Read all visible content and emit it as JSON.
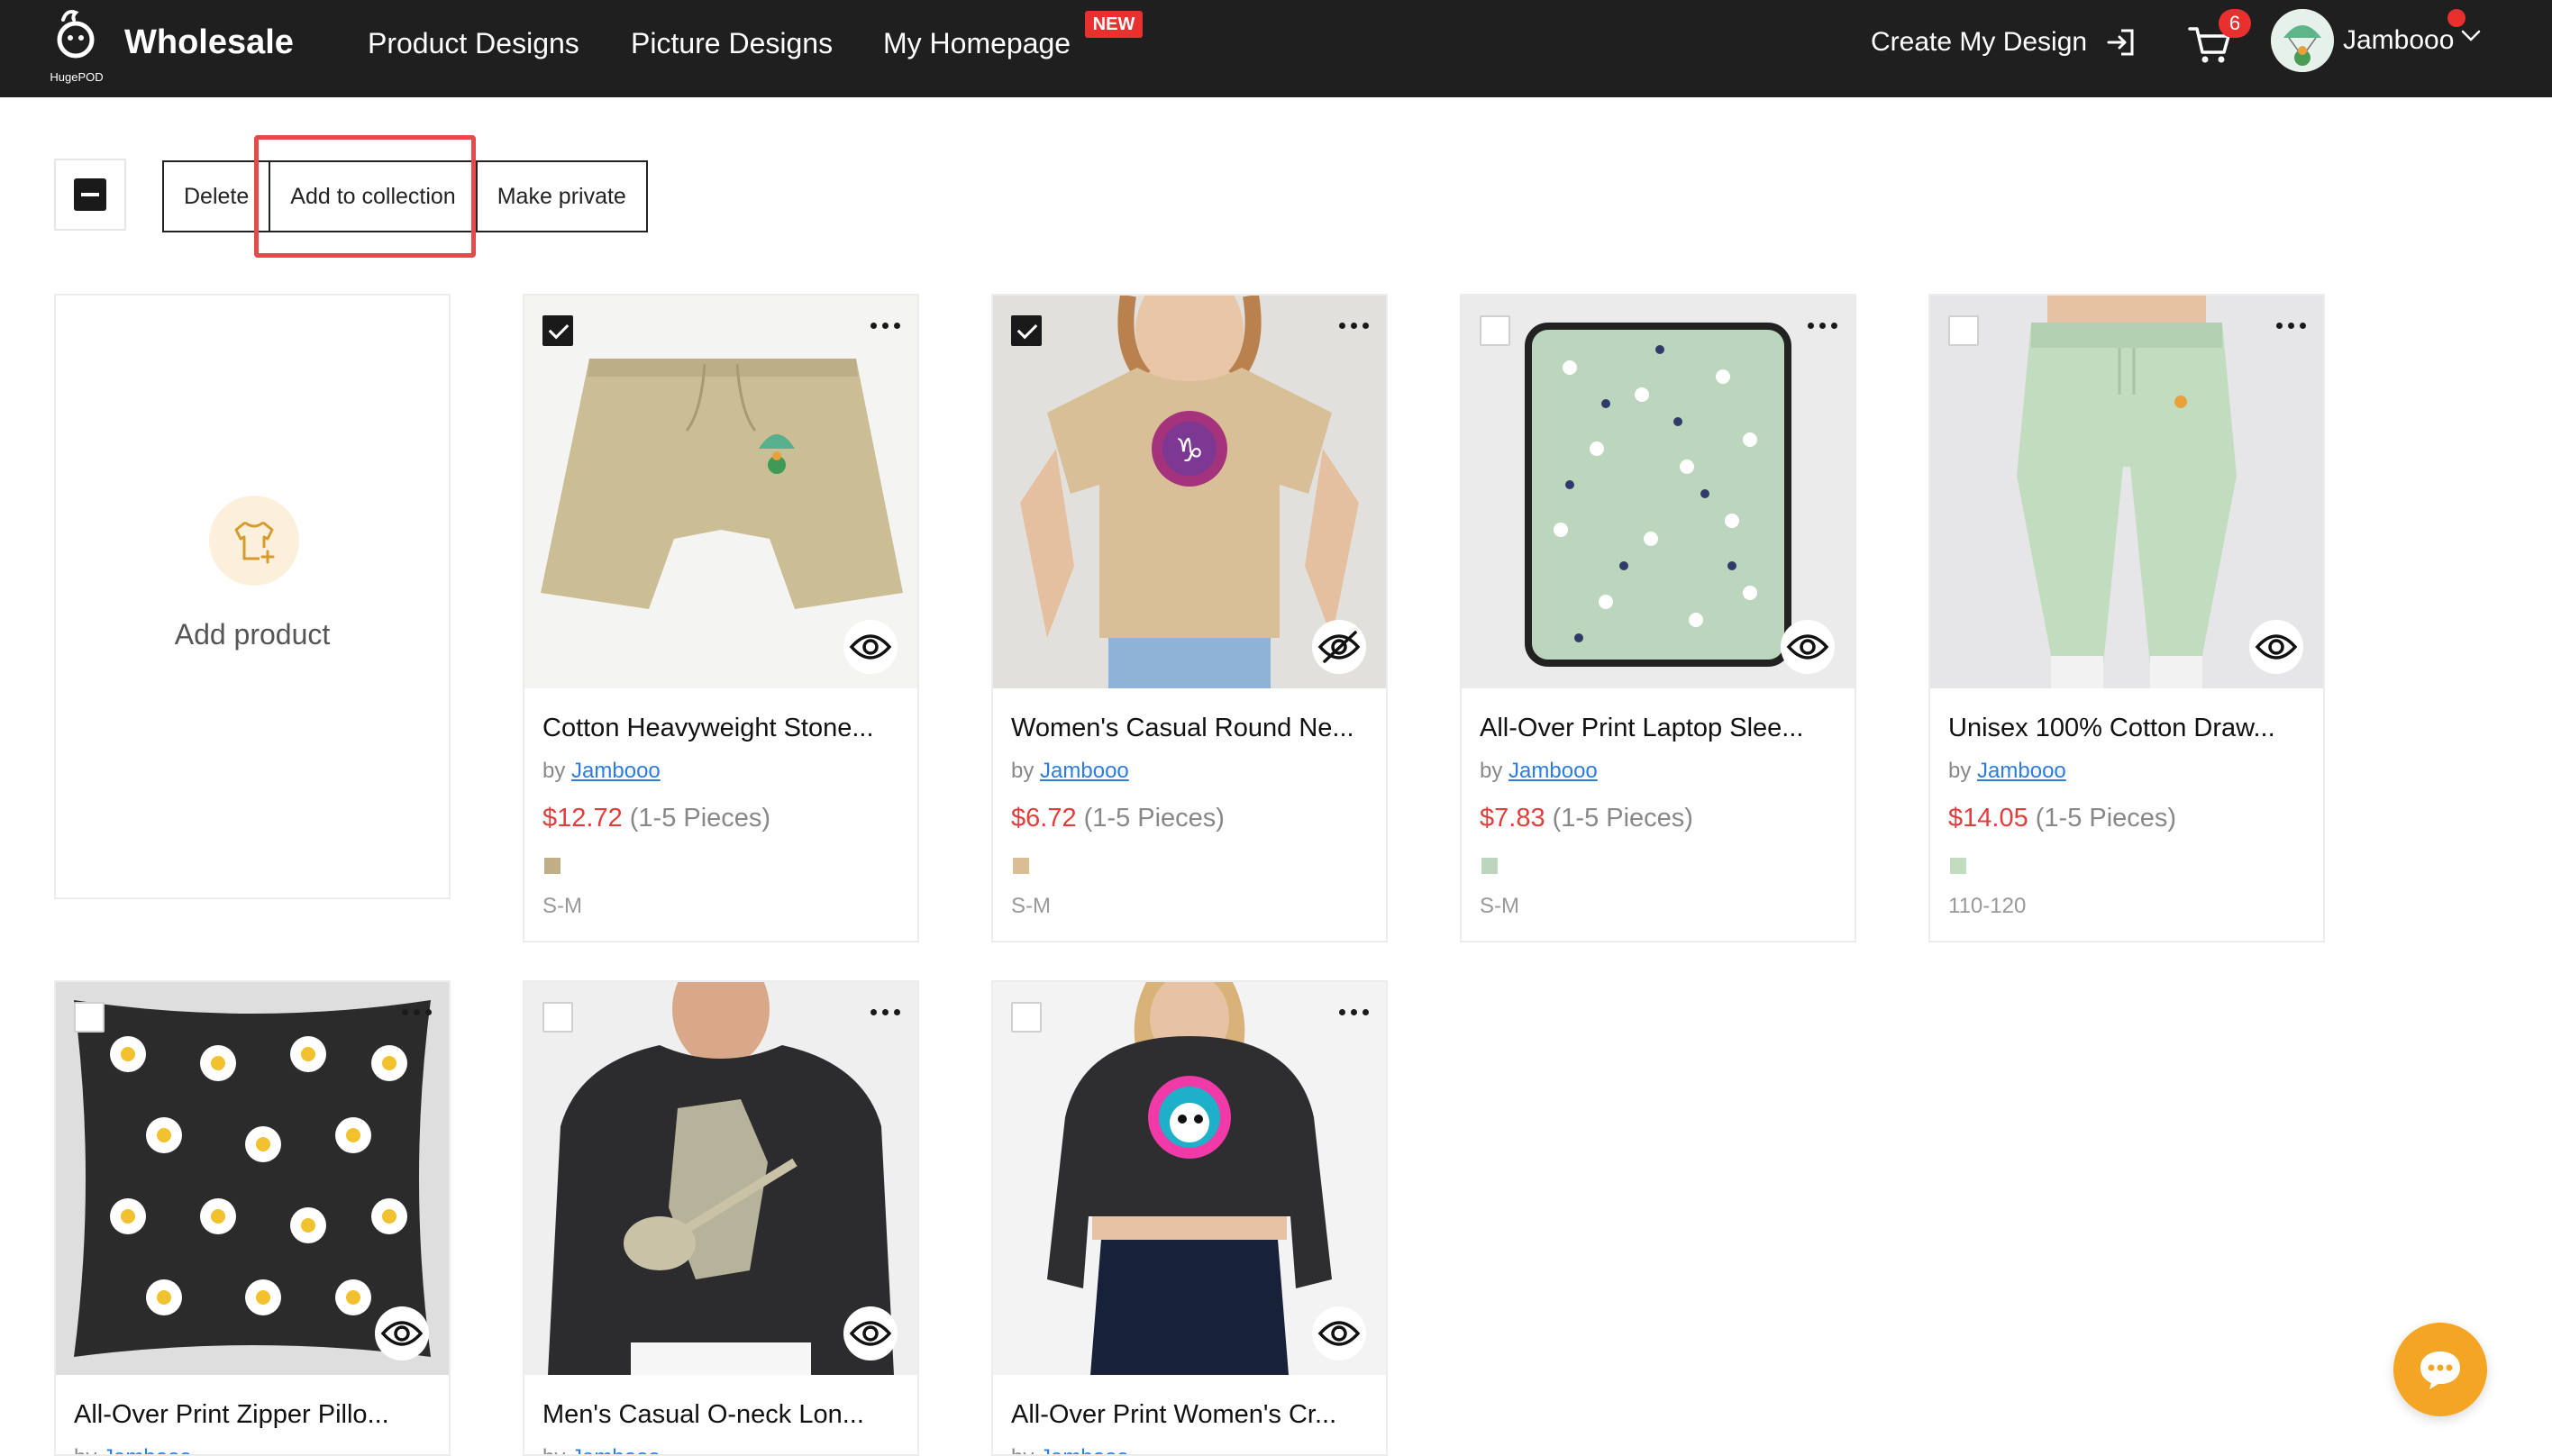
{
  "header": {
    "logo_text": "HugePOD",
    "brand": "Wholesale",
    "nav": [
      "Product Designs",
      "Picture Designs",
      "My Homepage"
    ],
    "new_badge": "NEW",
    "create_design": "Create My Design",
    "cart_count": "6",
    "user_name": "Jambooo"
  },
  "toolbar": {
    "delete": "Delete",
    "add_to_collection": "Add to collection",
    "make_private": "Make private"
  },
  "add_card": {
    "label": "Add product"
  },
  "products": [
    {
      "title": "Cotton Heavyweight Stone...",
      "by": "by",
      "author": "Jambooo",
      "price": "$12.72",
      "qty": "(1-5 Pieces)",
      "size": "S-M",
      "swatch": "#bfae86",
      "checked": true,
      "visible": true
    },
    {
      "title": "Women's Casual Round Ne...",
      "by": "by",
      "author": "Jambooo",
      "price": "$6.72",
      "qty": "(1-5 Pieces)",
      "size": "S-M",
      "swatch": "#d9bd94",
      "checked": true,
      "visible": false
    },
    {
      "title": "All-Over Print Laptop Slee...",
      "by": "by",
      "author": "Jambooo",
      "price": "$7.83",
      "qty": "(1-5 Pieces)",
      "size": "S-M",
      "swatch": "#bcd6bd",
      "checked": false,
      "visible": true
    },
    {
      "title": "Unisex 100% Cotton Draw...",
      "by": "by",
      "author": "Jambooo",
      "price": "$14.05",
      "qty": "(1-5 Pieces)",
      "size": "110-120",
      "swatch": "#c2dcc0",
      "checked": false,
      "visible": true
    },
    {
      "title": "All-Over Print Zipper Pillo...",
      "by": "by",
      "author": "Jambooo",
      "checked": false,
      "visible": true
    },
    {
      "title": "Men's Casual O-neck Lon...",
      "by": "by",
      "author": "Jambooo",
      "checked": false,
      "visible": true
    },
    {
      "title": "All-Over Print Women's Cr...",
      "by": "by",
      "author": "Jambooo",
      "checked": false,
      "visible": true
    }
  ],
  "colors": {
    "accent_red": "#e23d3d",
    "link_blue": "#2d7ce0",
    "header_bg": "#1f1f1f",
    "chat_orange": "#f5a524"
  },
  "icons": [
    "hugepod-logo-icon",
    "login-arrow-icon",
    "cart-icon",
    "chevron-down-icon",
    "shirt-plus-icon",
    "more-dots-icon",
    "eye-icon",
    "eye-off-icon",
    "chat-icon"
  ]
}
